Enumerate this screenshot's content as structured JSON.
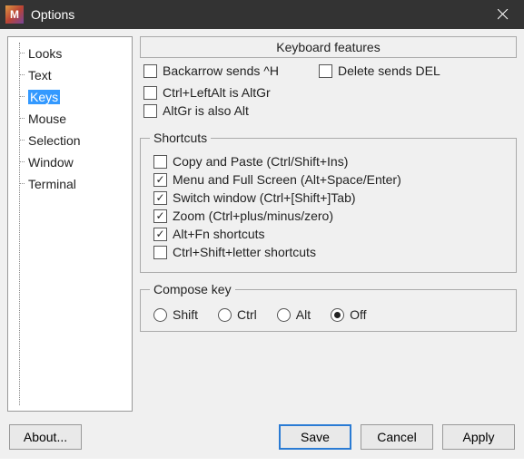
{
  "window": {
    "title": "Options",
    "icon_letter": "M"
  },
  "nav": {
    "items": [
      {
        "label": "Looks"
      },
      {
        "label": "Text"
      },
      {
        "label": "Keys",
        "selected": true
      },
      {
        "label": "Mouse"
      },
      {
        "label": "Selection"
      },
      {
        "label": "Window"
      },
      {
        "label": "Terminal"
      }
    ]
  },
  "kbfeatures": {
    "header": "Keyboard features",
    "backarrow": {
      "label": "Backarrow sends ^H",
      "checked": false
    },
    "delete": {
      "label": "Delete sends DEL",
      "checked": false
    },
    "ctrlalt": {
      "label": "Ctrl+LeftAlt is AltGr",
      "checked": false
    },
    "altgralt": {
      "label": "AltGr is also Alt",
      "checked": false
    }
  },
  "shortcuts": {
    "legend": "Shortcuts",
    "copypaste": {
      "label": "Copy and Paste (Ctrl/Shift+Ins)",
      "checked": false
    },
    "menufs": {
      "label": "Menu and Full Screen (Alt+Space/Enter)",
      "checked": true
    },
    "switchwin": {
      "label": "Switch window (Ctrl+[Shift+]Tab)",
      "checked": true
    },
    "zoom": {
      "label": "Zoom (Ctrl+plus/minus/zero)",
      "checked": true
    },
    "altfn": {
      "label": "Alt+Fn shortcuts",
      "checked": true
    },
    "csletter": {
      "label": "Ctrl+Shift+letter shortcuts",
      "checked": false
    }
  },
  "compose": {
    "legend": "Compose key",
    "options": [
      {
        "label": "Shift",
        "checked": false
      },
      {
        "label": "Ctrl",
        "checked": false
      },
      {
        "label": "Alt",
        "checked": false
      },
      {
        "label": "Off",
        "checked": true
      }
    ]
  },
  "buttons": {
    "about": "About...",
    "save": "Save",
    "cancel": "Cancel",
    "apply": "Apply"
  }
}
